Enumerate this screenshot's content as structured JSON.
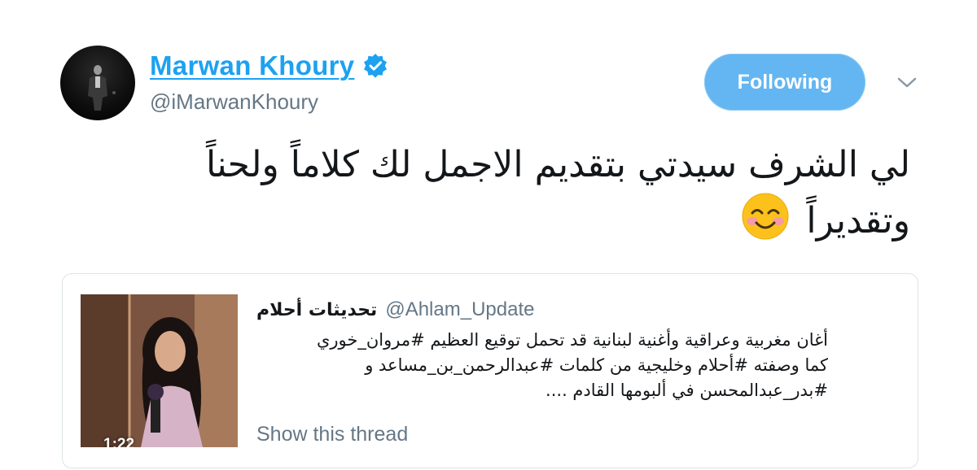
{
  "author": {
    "display_name": "Marwan Khoury",
    "handle": "@iMarwanKhoury",
    "verified": true
  },
  "follow_button": {
    "label": "Following"
  },
  "menu": {
    "icon": "chevron-down-icon"
  },
  "tweet": {
    "line1": "لي الشرف سيدتي بتقديم الاجمل لك كلاماً ولحناً",
    "line2": "وتقديراً",
    "emoji": "smiling-face-icon"
  },
  "quoted_tweet": {
    "display_name": "تحديثات أحلام",
    "handle": "@Ahlam_Update",
    "lines": [
      "أغان مغربية وعراقية وأغنية لبنانية قد تحمل توقيع العظيم #مروان_خوري",
      "كما وصفته #أحلام وخليجية من كلمات #عبدالرحمن_بن_مساعد و",
      "#بدر_عبدالمحسن في ألبومها القادم ...."
    ],
    "video_duration": "1:22",
    "show_thread": "Show this thread"
  },
  "colors": {
    "accent": "#1da1f2",
    "following_bg": "#63b6f1",
    "secondary_text": "#657786",
    "border": "#dde3e8"
  }
}
